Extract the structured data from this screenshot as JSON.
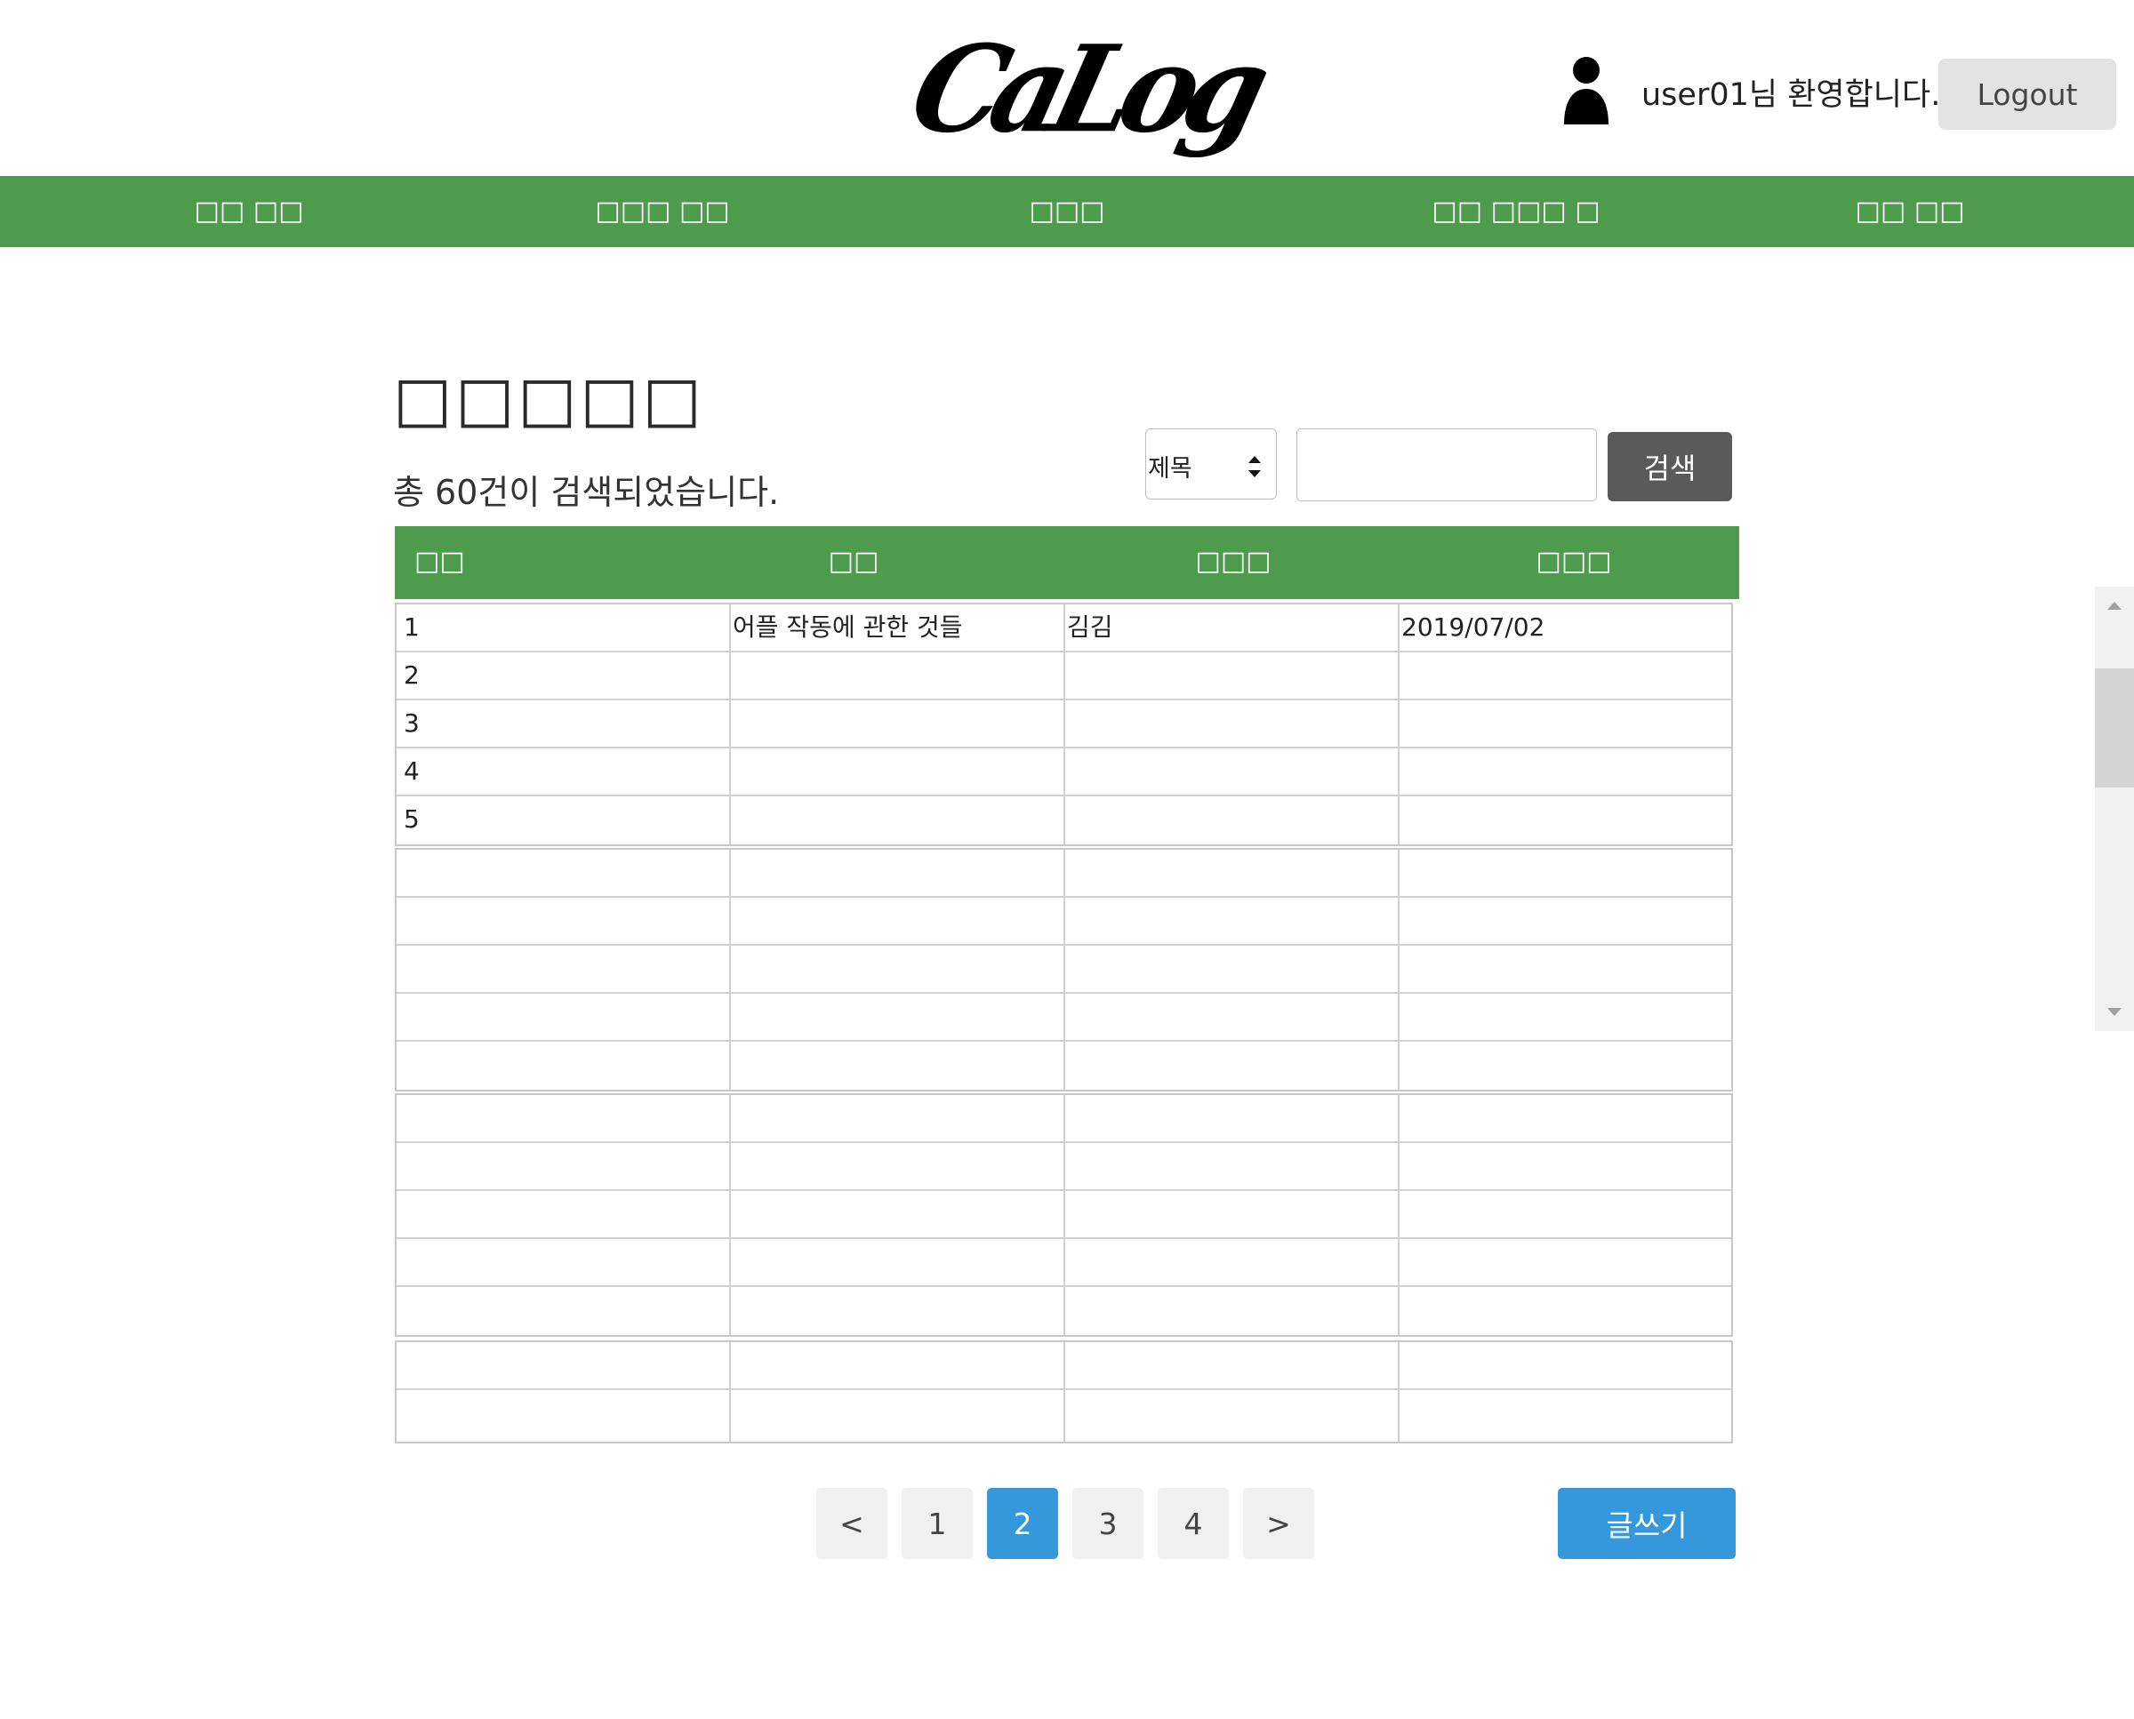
{
  "header": {
    "logo_text": "CaLog",
    "welcome": "user01님 환영합니다.",
    "logout_label": "Logout"
  },
  "nav": {
    "items": [
      {
        "label": "□□ □□"
      },
      {
        "label": "□□□ □□"
      },
      {
        "label": "□□□"
      },
      {
        "label": "□□ □□□ □"
      },
      {
        "label": "□□ □□"
      }
    ]
  },
  "main": {
    "title": "□□□□□",
    "result_count": "총 60건이 검색되었습니다.",
    "search": {
      "select_value": "제목",
      "input_value": "",
      "button_label": "검색"
    }
  },
  "table": {
    "headers": [
      "□□",
      "□□",
      "□□□",
      "□□□"
    ],
    "groups": [
      [
        [
          "1",
          "어플 작동에 관한 것들",
          "김김",
          "2019/07/02"
        ],
        [
          "2",
          "",
          "",
          ""
        ],
        [
          "3",
          "",
          "",
          ""
        ],
        [
          "4",
          "",
          "",
          ""
        ],
        [
          "5",
          "",
          "",
          ""
        ]
      ],
      [
        [
          "",
          "",
          "",
          ""
        ],
        [
          "",
          "",
          "",
          ""
        ],
        [
          "",
          "",
          "",
          ""
        ],
        [
          "",
          "",
          "",
          ""
        ],
        [
          "",
          "",
          "",
          ""
        ]
      ],
      [
        [
          "",
          "",
          "",
          ""
        ],
        [
          "",
          "",
          "",
          ""
        ],
        [
          "",
          "",
          "",
          ""
        ],
        [
          "",
          "",
          "",
          ""
        ],
        [
          "",
          "",
          "",
          ""
        ]
      ],
      [
        [
          "",
          "",
          "",
          ""
        ],
        [
          "",
          "",
          "",
          ""
        ]
      ]
    ]
  },
  "pagination": {
    "prev": "<",
    "pages": [
      "1",
      "2",
      "3",
      "4"
    ],
    "current": "2",
    "next": ">"
  },
  "write_label": "글쓰기",
  "colors": {
    "nav_green": "#4e9b4e",
    "primary_blue": "#3598dc",
    "search_button": "#5a5a5a"
  },
  "icons": {
    "user": "user-icon",
    "select_arrows": "select-arrows-icon",
    "scroll_up": "scroll-up-icon",
    "scroll_down": "scroll-down-icon"
  }
}
